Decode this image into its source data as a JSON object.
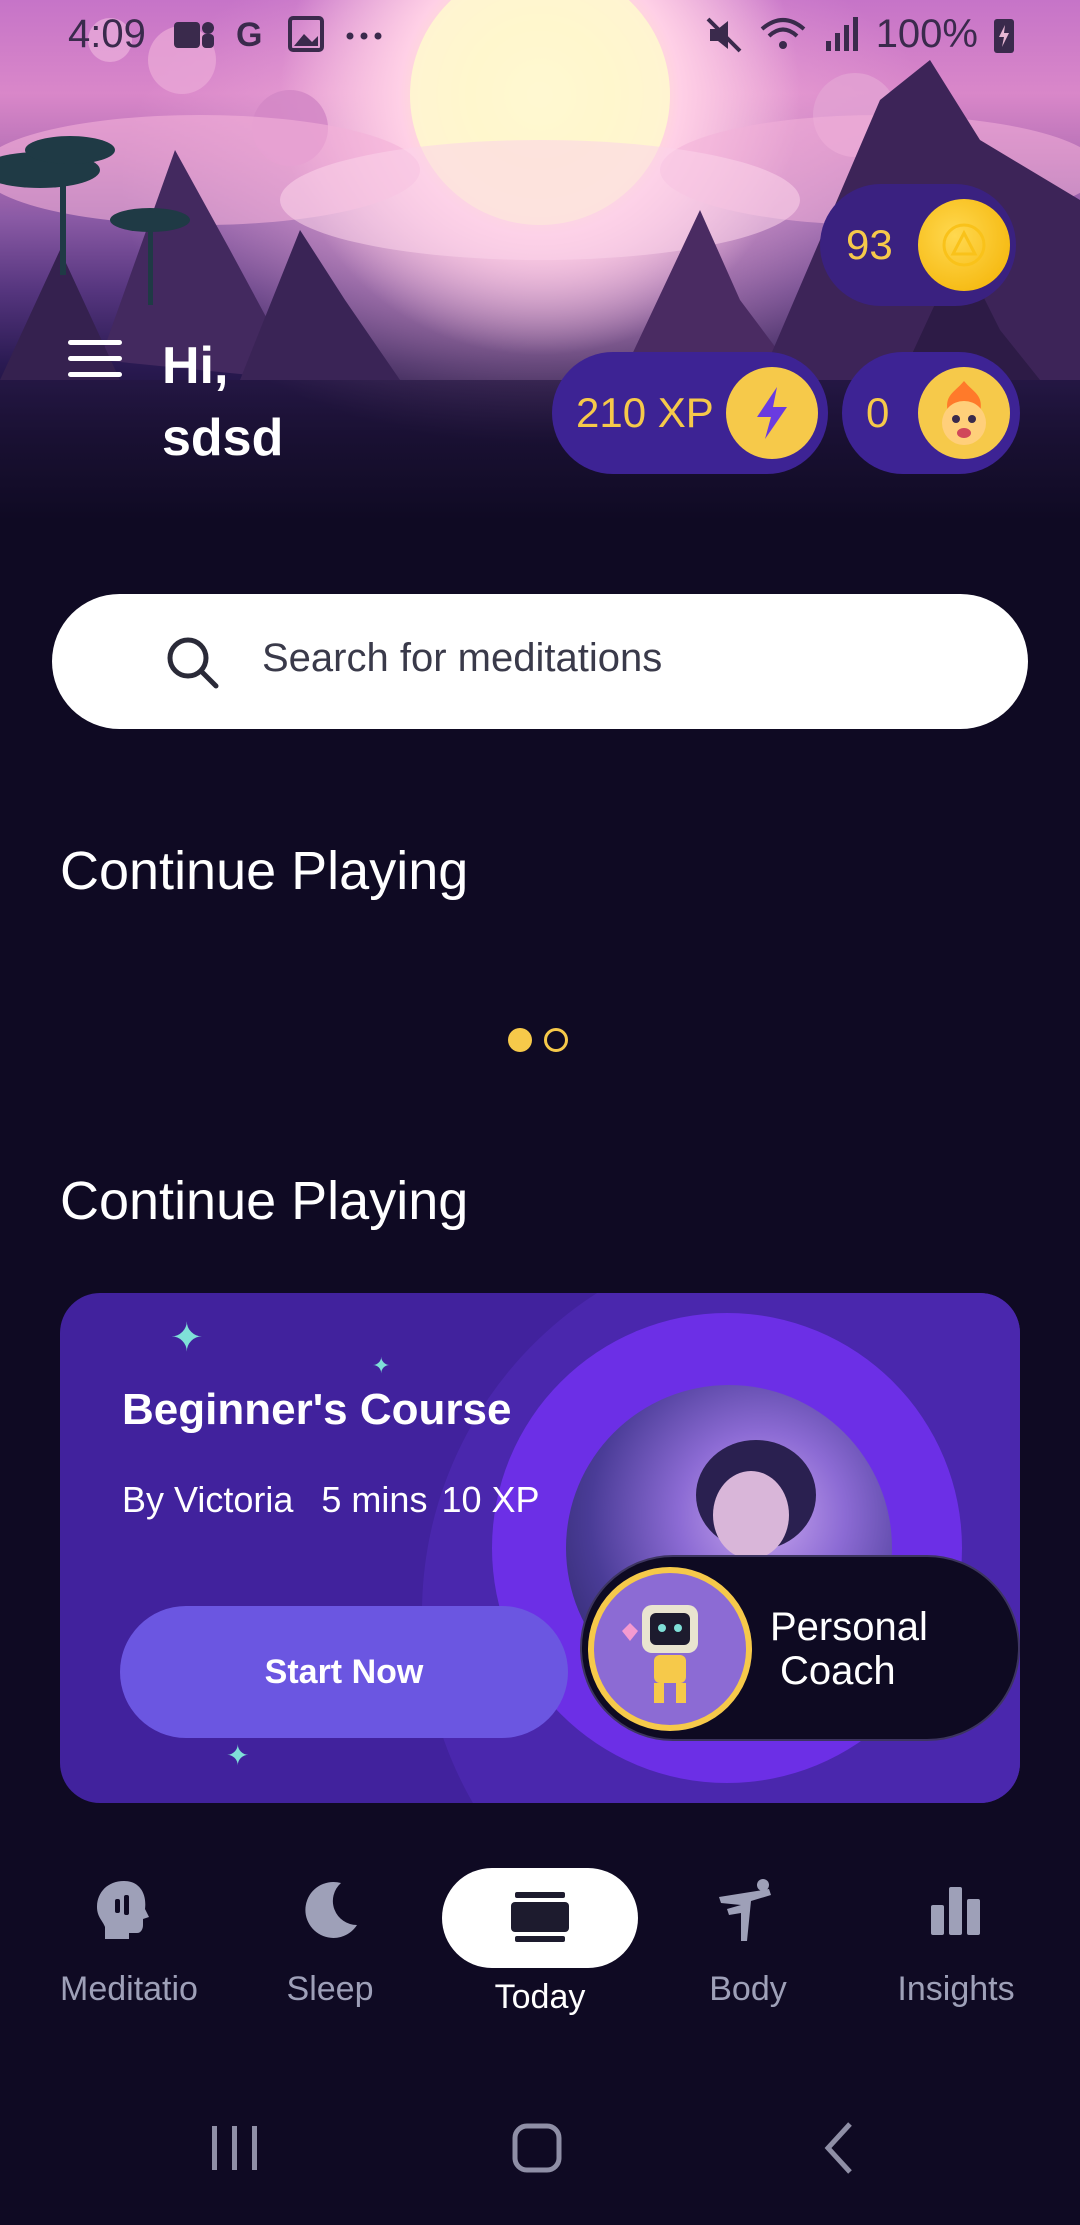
{
  "status_bar": {
    "time": "4:09",
    "battery": "100%"
  },
  "header": {
    "greeting_line1": "Hi,",
    "greeting_line2": "sdsd",
    "coins": "93",
    "xp": "210 XP",
    "streak": "0"
  },
  "search": {
    "placeholder": "Search for meditations"
  },
  "sections": {
    "continue_playing_1": "Continue Playing",
    "continue_playing_2": "Continue Playing"
  },
  "carousel": {
    "active_index": 0,
    "count": 2
  },
  "course_card": {
    "title": "Beginner's Course",
    "author": "By Victoria",
    "duration": "5 mins",
    "xp": "10 XP",
    "start_label": "Start Now"
  },
  "coach": {
    "line1": "Personal",
    "line2": "Coach"
  },
  "bottom_nav": {
    "items": [
      {
        "label": "Meditatio",
        "icon": "head-icon"
      },
      {
        "label": "Sleep",
        "icon": "moon-icon"
      },
      {
        "label": "Today",
        "icon": "today-icon",
        "active": true
      },
      {
        "label": "Body",
        "icon": "stretch-icon"
      },
      {
        "label": "Insights",
        "icon": "bar-chart-icon"
      }
    ]
  },
  "colors": {
    "accent_yellow": "#f6c94a",
    "pill_bg": "#3d2394",
    "background": "#0f0a23",
    "card_bg": "#41229d",
    "button": "#6b56e1"
  }
}
